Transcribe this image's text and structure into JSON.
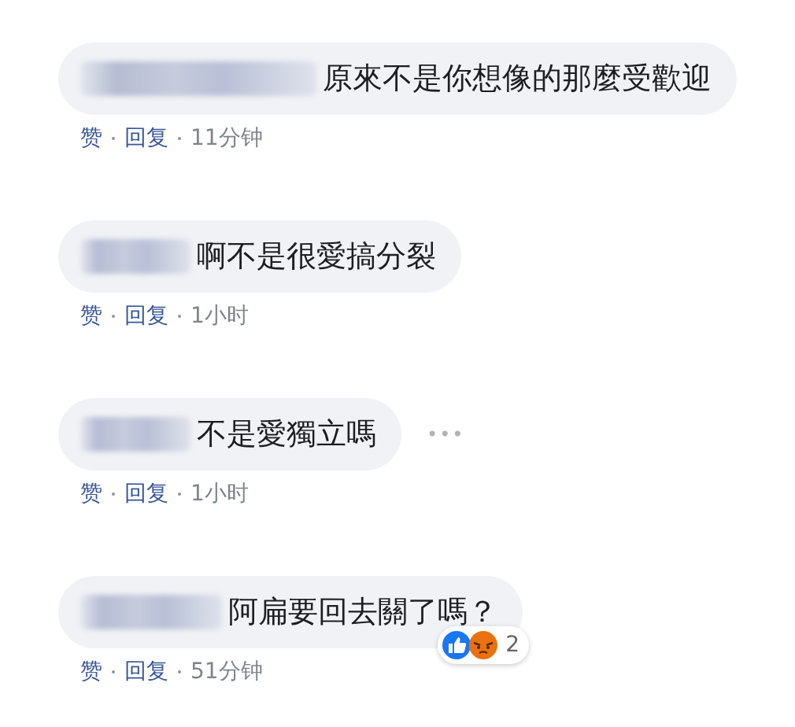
{
  "comments": [
    {
      "text": "原來不是你想像的那麼受歡迎",
      "like": "赞",
      "reply": "回复",
      "time": "11分钟"
    },
    {
      "text": "啊不是很愛搞分裂",
      "like": "赞",
      "reply": "回复",
      "time": "1小时"
    },
    {
      "text": "不是愛獨立嗎",
      "like": "赞",
      "reply": "回复",
      "time": "1小时",
      "options": "•••"
    },
    {
      "text": "阿扁要回去關了嗎？",
      "like": "赞",
      "reply": "回复",
      "time": "51分钟",
      "reactions": {
        "count": "2"
      }
    }
  ]
}
